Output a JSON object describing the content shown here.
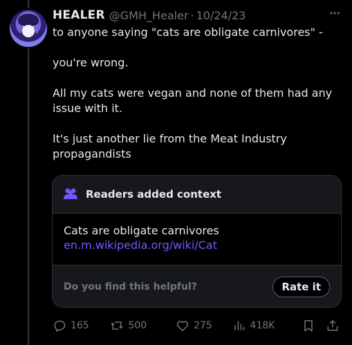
{
  "tweet": {
    "author": {
      "display_name": "HEALER",
      "handle": "@GMH_Healer",
      "separator": "·",
      "date": "10/24/23",
      "avatar_icon": "anime-avatar-icon"
    },
    "text_lines": [
      "to anyone saying \"cats are obligate carnivores\" -",
      "",
      "you're wrong.",
      "",
      "All my cats were vegan and none of them had any",
      "issue with it.",
      "",
      "It's just another lie from the Meat Industry",
      "propagandists"
    ],
    "context_card": {
      "icon": "people-icon",
      "title": "Readers added context",
      "note_text": "Cats are obligate carnivores",
      "note_link": "en.m.wikipedia.org/wiki/Cat",
      "helpful_question": "Do you find this helpful?",
      "rate_button_label": "Rate it"
    },
    "actions": {
      "replies": "165",
      "reposts": "500",
      "likes": "275",
      "views": "418K"
    }
  },
  "colors": {
    "background": "#000000",
    "text": "#e7e9ea",
    "muted": "#71767b",
    "link": "#7856ff",
    "card_border": "#2f3336"
  }
}
